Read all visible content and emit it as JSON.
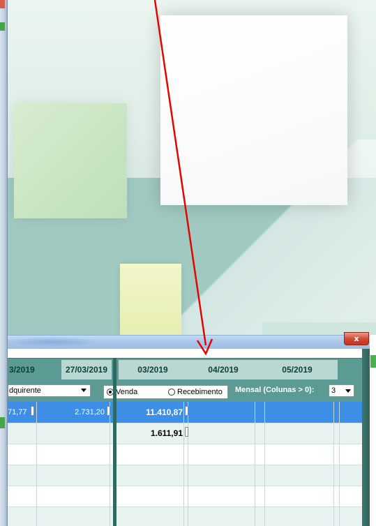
{
  "window": {
    "close_label": "x"
  },
  "grid": {
    "headers": {
      "col1": "3/2019",
      "col2": "27/03/2019",
      "col3": "03/2019",
      "col4": "04/2019",
      "col5": "05/2019"
    },
    "filter": {
      "adquirente_value": "dquirente",
      "radio_venda_label": "Venda",
      "radio_venda_selected": true,
      "radio_recebimento_label": "Recebimento",
      "radio_recebimento_selected": false,
      "mensal_label": "Mensal (Colunas > 0):",
      "mensal_value": "3"
    },
    "rows": [
      {
        "c1": "71,77",
        "c2": "2.731,20",
        "c3": "11.410,87",
        "selected": true
      },
      {
        "c1": "",
        "c2": "",
        "c3": "1.611,91",
        "selected": false
      },
      {
        "c1": "",
        "c2": "",
        "c3": "",
        "selected": false
      },
      {
        "c1": "",
        "c2": "",
        "c3": "",
        "selected": false
      },
      {
        "c1": "",
        "c2": "",
        "c3": "",
        "selected": false
      },
      {
        "c1": "",
        "c2": "",
        "c3": "",
        "selected": false
      }
    ]
  },
  "annotation": {
    "arrow_color": "#e10600"
  },
  "colors": {
    "header_teal": "#5c9b93",
    "header_light": "#b9d8d3",
    "selected_row": "#3d8ee6",
    "alt_row": "#e8f3f1"
  }
}
